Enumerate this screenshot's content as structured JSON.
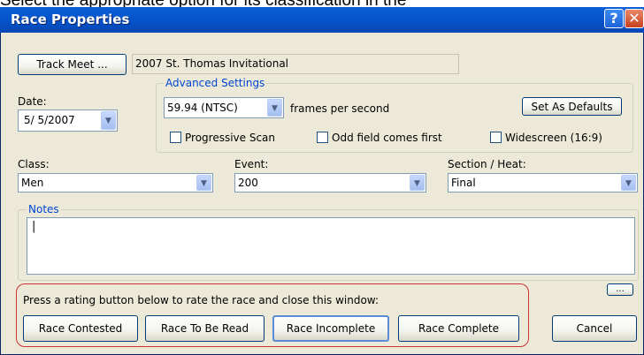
{
  "overhead_text": "Select the appropriate option for its classification in the",
  "window": {
    "title": "Race Properties",
    "help_glyph": "?",
    "close_glyph": "✕"
  },
  "track_meet": {
    "button_label": "Track Meet ...",
    "value": "2007 St. Thomas Invitational"
  },
  "date": {
    "label": "Date:",
    "value": "5/ 5/2007"
  },
  "advanced": {
    "legend": "Advanced Settings",
    "fps_value": "59.94 (NTSC)",
    "fps_suffix": "frames per second",
    "defaults_button": "Set As Defaults",
    "progressive_label": "Progressive Scan",
    "odd_field_label": "Odd field comes first",
    "widescreen_label": "Widescreen (16:9)"
  },
  "class": {
    "label": "Class:",
    "value": "Men"
  },
  "event": {
    "label": "Event:",
    "value": "200"
  },
  "section": {
    "label": "Section / Heat:",
    "value": "Final"
  },
  "notes": {
    "legend": "Notes",
    "value": "|"
  },
  "ellipsis_button": "...",
  "rating": {
    "prompt": "Press a rating button below to rate the race and close this window:",
    "buttons": [
      "Race Contested",
      "Race To Be Read",
      "Race Incomplete",
      "Race Complete"
    ]
  },
  "cancel_button": "Cancel",
  "colors": {
    "titlebar": "#0553c9",
    "dialog_bg": "#ece9d8",
    "group_legend": "#0046d5",
    "rating_border": "#cc3333"
  },
  "icons": {
    "dropdown": "chevron-down-icon",
    "help": "help-icon",
    "close": "close-icon"
  }
}
